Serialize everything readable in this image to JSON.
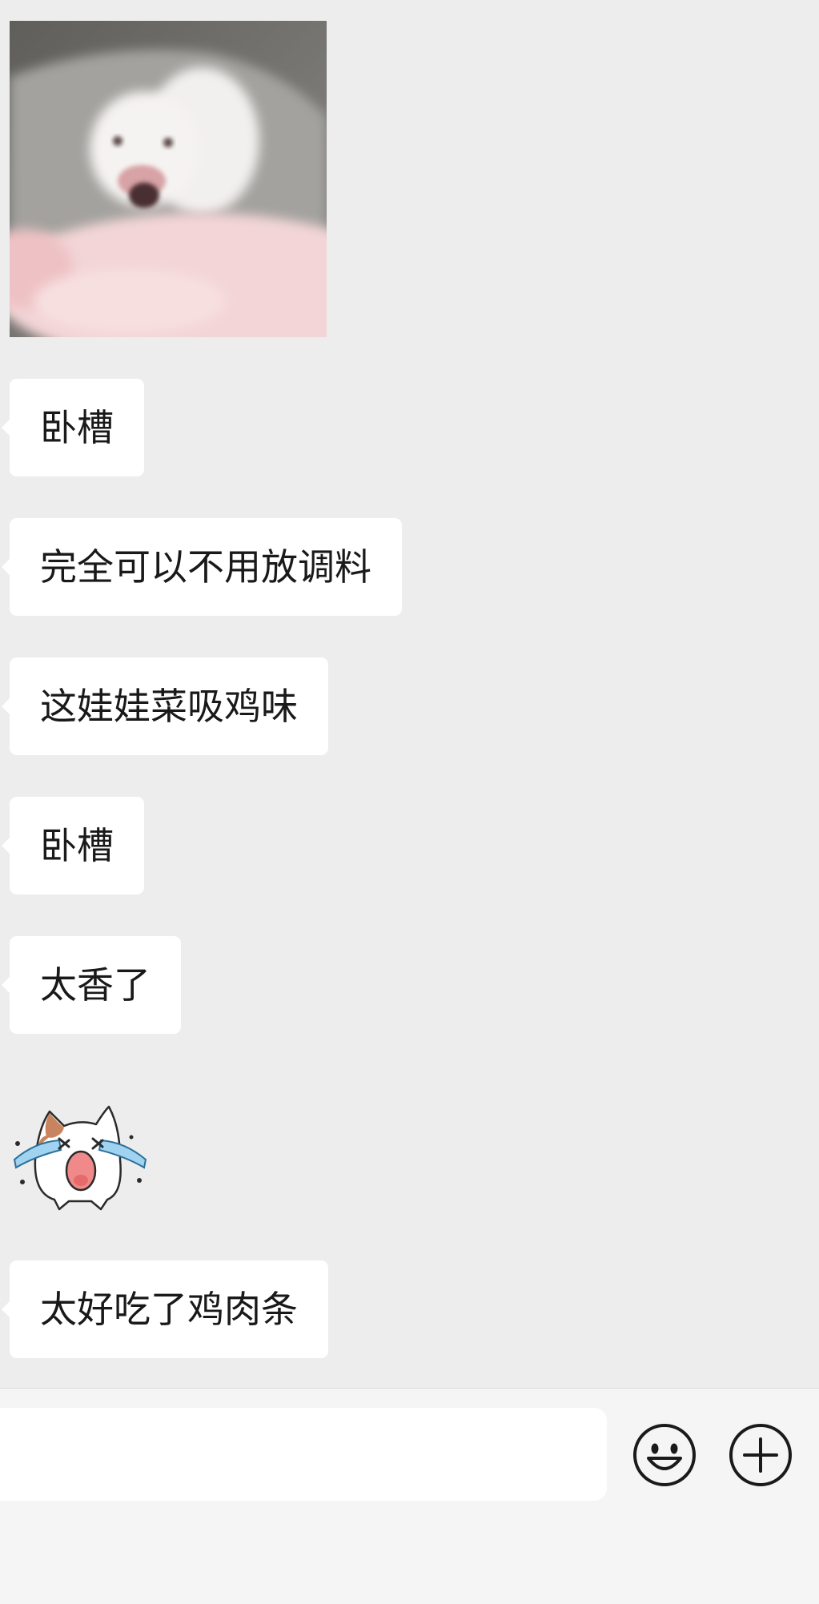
{
  "chat": {
    "messages": [
      {
        "type": "image",
        "image": "pig-photo"
      },
      {
        "type": "text",
        "text": "卧槽"
      },
      {
        "type": "text",
        "text": "完全可以不用放调料"
      },
      {
        "type": "text",
        "text": "这娃娃菜吸鸡味"
      },
      {
        "type": "text",
        "text": "卧槽"
      },
      {
        "type": "text",
        "text": "太香了"
      },
      {
        "type": "sticker",
        "image": "crying-cat-sticker"
      },
      {
        "type": "text",
        "text": "太好吃了鸡肉条"
      }
    ]
  },
  "input_bar": {
    "text_value": "",
    "emoji_button_icon": "smiley-face-icon",
    "more_button_icon": "plus-circle-icon"
  },
  "colors": {
    "chat_background": "#ededed",
    "bubble_background": "#ffffff",
    "message_text": "#191919",
    "input_bar_background": "#f5f5f5",
    "icon_stroke": "#1a1a1a"
  }
}
